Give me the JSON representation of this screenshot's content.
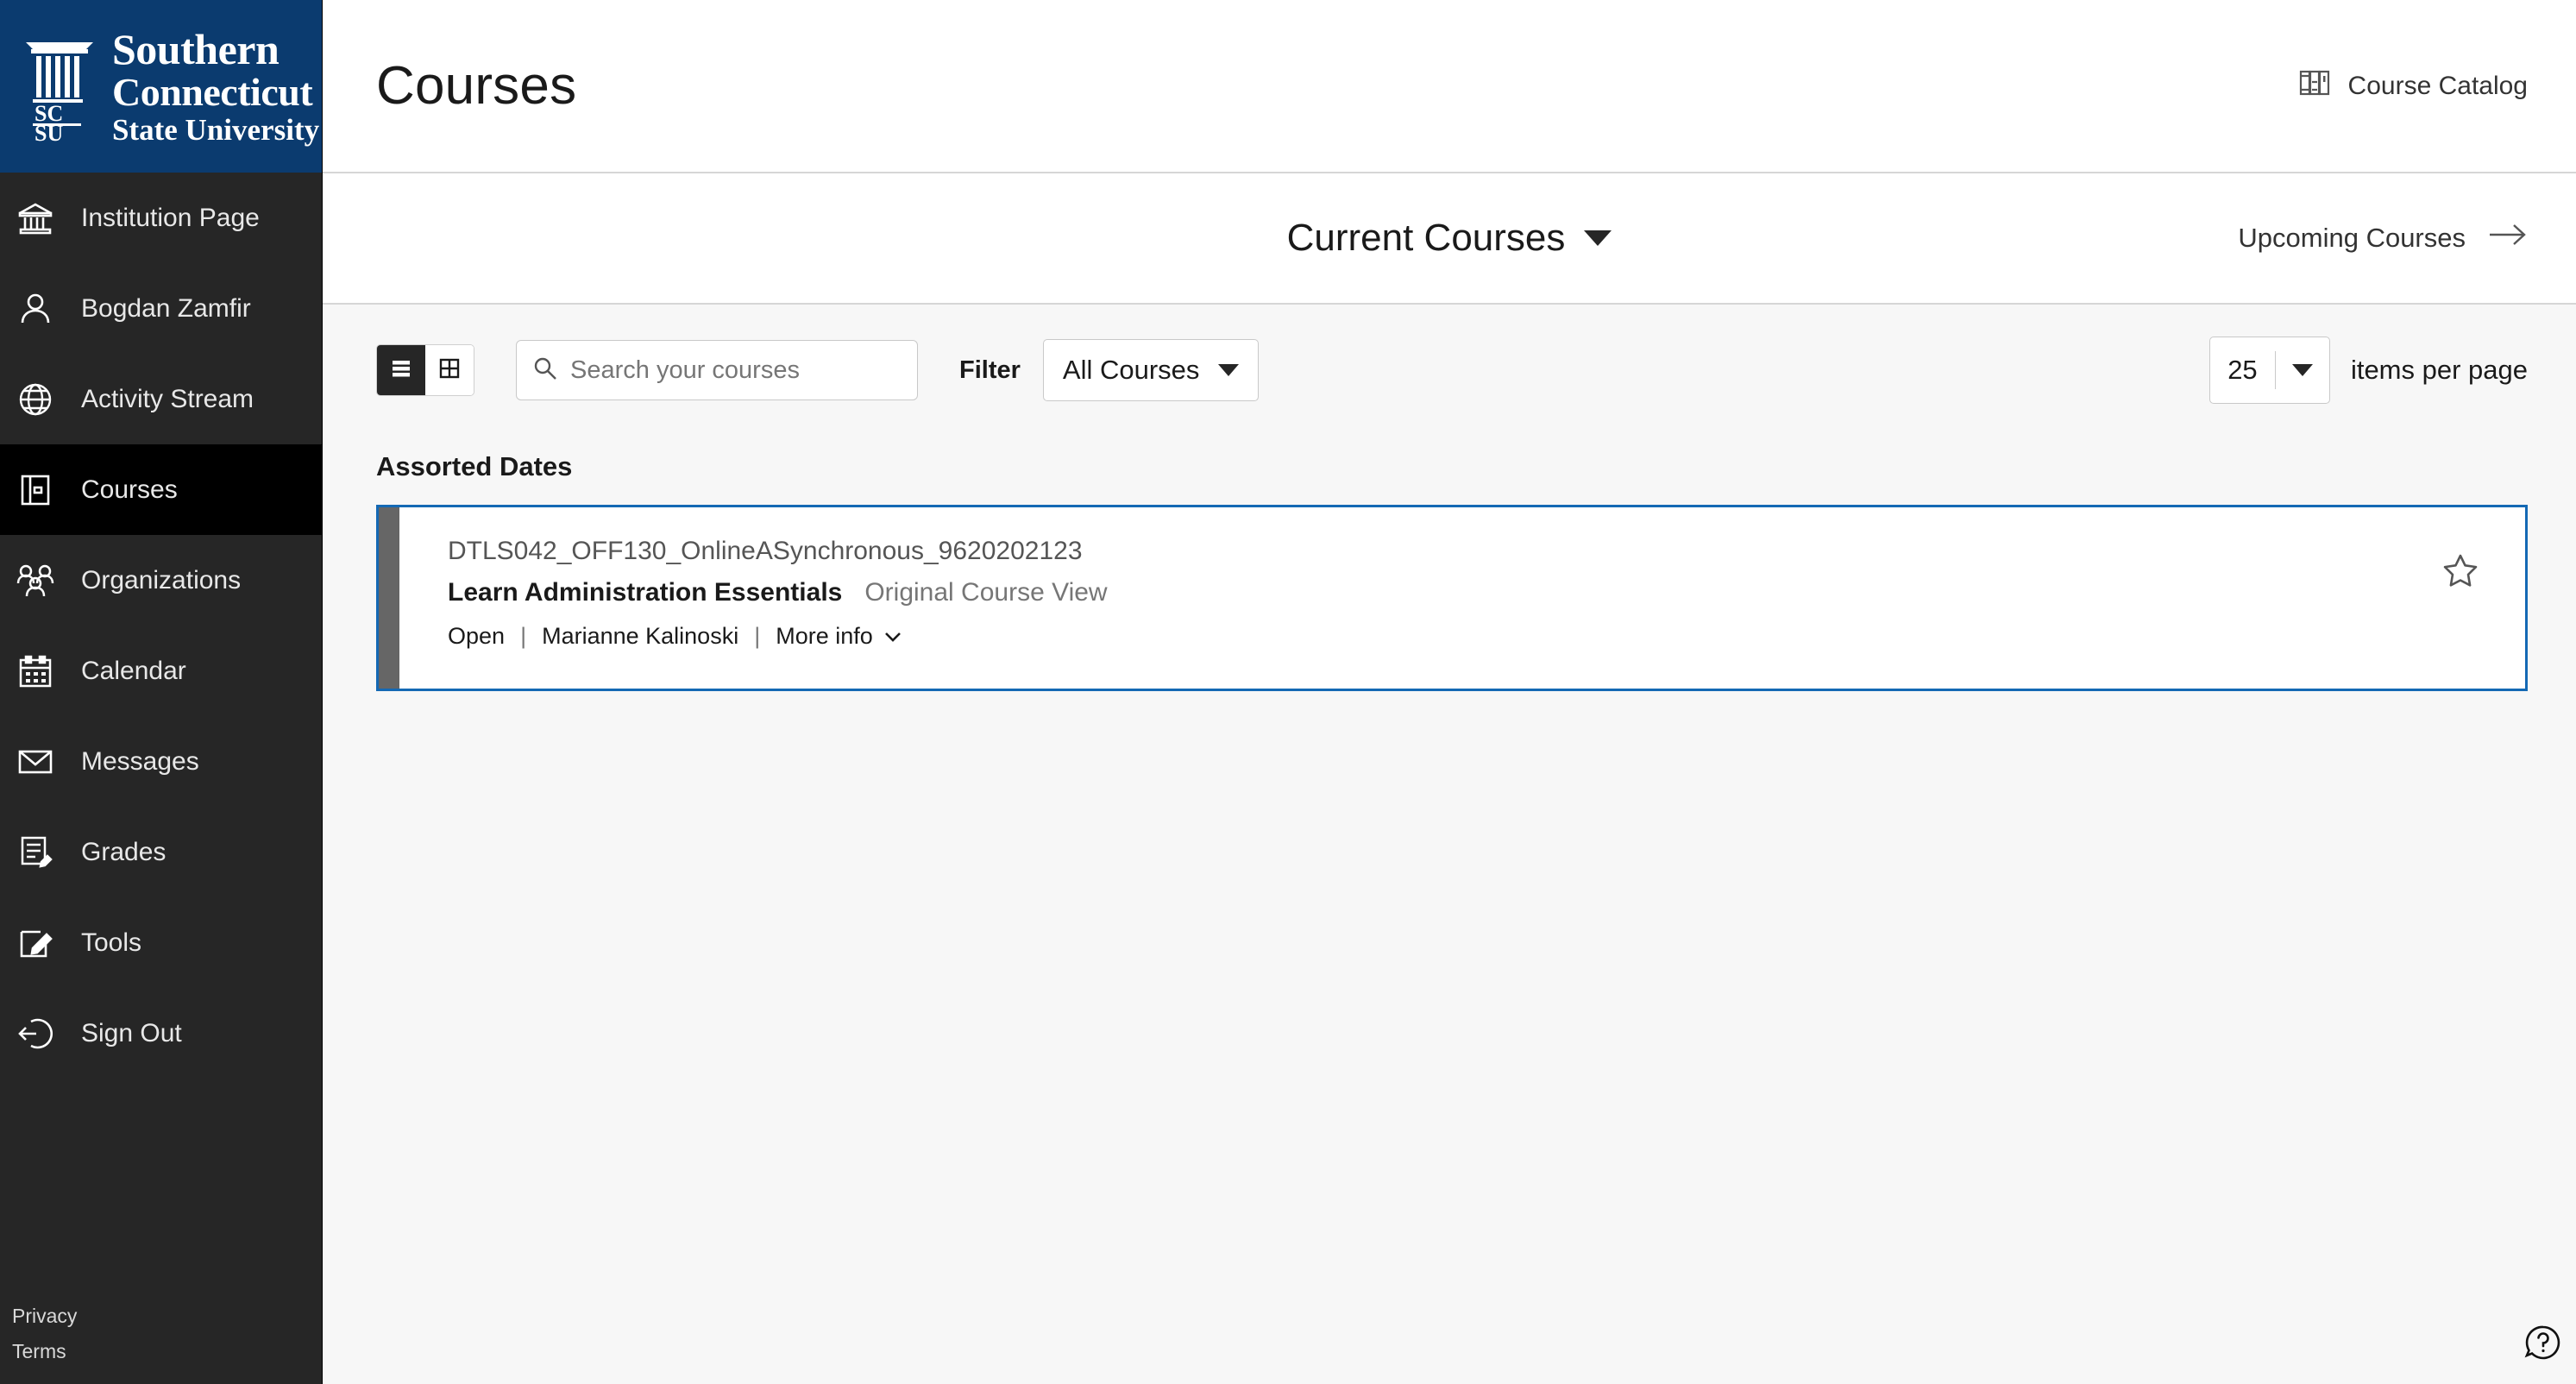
{
  "brand": {
    "line1": "Southern",
    "line2": "Connecticut",
    "line3": "State University",
    "mark_top": "SC",
    "mark_bottom": "SU",
    "bg_color": "#0b3b6f"
  },
  "sidebar": {
    "items": [
      {
        "label": "Institution Page",
        "icon": "bank-icon",
        "active": false
      },
      {
        "label": "Bogdan Zamfir",
        "icon": "user-icon",
        "active": false
      },
      {
        "label": "Activity Stream",
        "icon": "globe-icon",
        "active": false
      },
      {
        "label": "Courses",
        "icon": "courses-icon",
        "active": true
      },
      {
        "label": "Organizations",
        "icon": "people-icon",
        "active": false
      },
      {
        "label": "Calendar",
        "icon": "calendar-icon",
        "active": false
      },
      {
        "label": "Messages",
        "icon": "envelope-icon",
        "active": false
      },
      {
        "label": "Grades",
        "icon": "grades-icon",
        "active": false
      },
      {
        "label": "Tools",
        "icon": "tools-icon",
        "active": false
      },
      {
        "label": "Sign Out",
        "icon": "sign-out-icon",
        "active": false
      }
    ],
    "footer": {
      "privacy": "Privacy",
      "terms": "Terms"
    }
  },
  "header": {
    "title": "Courses",
    "catalog_label": "Course Catalog",
    "catalog_icon": "bookshelf-icon"
  },
  "course_bar": {
    "current_label": "Current Courses",
    "upcoming_label": "Upcoming Courses"
  },
  "toolbar": {
    "list_view_icon": "list-view-icon",
    "grid_view_icon": "grid-view-icon",
    "active_view": "list",
    "search": {
      "placeholder": "Search your courses",
      "value": "",
      "icon": "search-icon"
    },
    "filter_label": "Filter",
    "filter_value": "All Courses",
    "items_per_page_value": "25",
    "items_per_page_label": "items per page"
  },
  "courses": {
    "group_title": "Assorted Dates",
    "cards": [
      {
        "course_id": "DTLS042_OFF130_OnlineASynchronous_9620202123",
        "name": "Learn Administration Essentials",
        "view_type": "Original Course View",
        "status": "Open",
        "instructor": "Marianne Kalinoski",
        "more_info": "More info",
        "separator": "|",
        "favorite": false,
        "border_color": "#1469b4",
        "accent_color": "#666666"
      }
    ]
  },
  "help": {
    "icon": "help-question-icon"
  }
}
